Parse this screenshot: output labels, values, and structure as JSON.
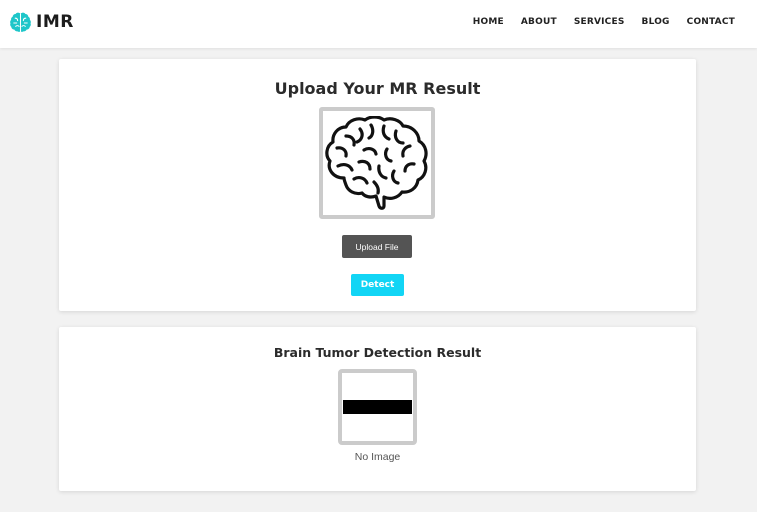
{
  "brand": {
    "name": "IMR",
    "icon": "brain-logo-icon",
    "icon_color": "#1ec6c9"
  },
  "nav": {
    "items": [
      {
        "label": "HOME"
      },
      {
        "label": "ABOUT"
      },
      {
        "label": "SERVICES"
      },
      {
        "label": "BLOG"
      },
      {
        "label": "CONTACT"
      }
    ]
  },
  "upload_section": {
    "title": "Upload Your MR Result",
    "image_icon": "brain-outline-icon",
    "upload_button_label": "Upload File",
    "detect_button_label": "Detect",
    "detect_button_color": "#12d5f5"
  },
  "result_section": {
    "title": "Brain Tumor Detection Result",
    "placeholder_icon": "no-image-placeholder-icon",
    "no_image_label": "No Image"
  }
}
